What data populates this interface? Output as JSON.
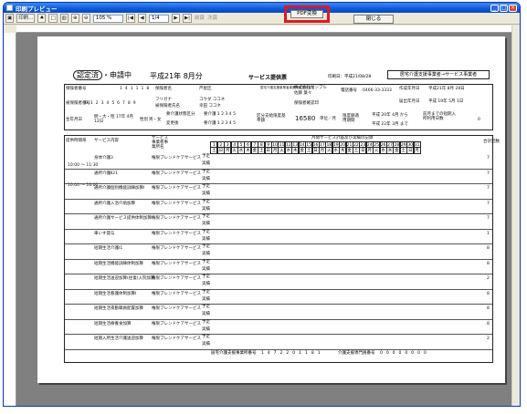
{
  "window": {
    "title": "印刷プレビュー",
    "min": "_",
    "max": "□",
    "close": "×"
  },
  "toolbar": {
    "print_label": "印刷...",
    "zoom": "105 %",
    "page": "1/4",
    "prev_label": "前頁",
    "next_label": "次頁",
    "pdf_label": "PDF変換",
    "close_label": "閉じる"
  },
  "doc": {
    "stamp_done": "認定済",
    "stamp_sep": "・",
    "stamp_applying": "申請中",
    "year_month": "平成21年 8月分",
    "title": "サービス提供票",
    "created": "印刷日：平成21/08/28",
    "provider_header": "居宅介護支援事業者→サービス事業者",
    "insured_no_label": "保険者番号",
    "insured_no": "141118",
    "insurer_name_label": "保険者名",
    "insurer_name": "芦屋区",
    "care_center_label": "居宅介護支援事業者事業所名担当者名",
    "care_center": "株式会社サンプル",
    "staff_label": "担当者",
    "staff": "佐藤 葉々",
    "phone_label": "電話番号",
    "phone": "0466-33-3333",
    "created_label": "作成年月日",
    "created_date": "平成21年 8月 28日",
    "person_no_label": "被保険者番号",
    "person_no": "0123456789",
    "furigana_label": "フリガナ",
    "furigana": "コウダ ココネ",
    "person_name_label": "被保険者氏名",
    "person_name": "幸田 ココネ",
    "insurer_confirm_label": "保険者確認印",
    "notify_label": "届出年月日",
    "notify_date": "平成 19年 5月 1日",
    "birth_label": "生年月日",
    "birth": "明・大・昭 17年 4月 12日",
    "sex_label": "性別",
    "sex": "男・女",
    "care_level_label": "要介護状態区分",
    "care_level": "要介護 1 2 3 4 5",
    "changed_label": "変更後",
    "changed_level": "要介護 1 2 3 4 5",
    "limit_label": "区分支給限度基準額",
    "limit": "16580",
    "limit_unit": "単位／月",
    "limit_period_label": "限度額適用期間",
    "period_from": "平成 20年 4月 から",
    "period_to": "平成 22年 3月 まで",
    "prev_month_label": "前月までの短期入所利用日数",
    "prev_month": "0",
    "col_time": "提供時間帯",
    "col_service": "サービス内容",
    "col_provider": "サービス事業者事業所名",
    "col_plan_actual": "予定/実績",
    "col_days_title": "月間サービス計画及び実績の記録",
    "col_total": "合計回数",
    "days": [
      "1",
      "2",
      "3",
      "4",
      "5",
      "6",
      "7",
      "8",
      "9",
      "10",
      "11",
      "12",
      "13",
      "14",
      "15",
      "16",
      "17",
      "18",
      "19",
      "20",
      "21",
      "22",
      "23",
      "24",
      "25",
      "26",
      "27",
      "28",
      "29",
      "30",
      "31"
    ],
    "weekdays": [
      "土",
      "日",
      "月",
      "火",
      "水",
      "木",
      "金",
      "土",
      "日",
      "月",
      "火",
      "水",
      "木",
      "金",
      "土",
      "日",
      "月",
      "火",
      "水",
      "木",
      "金",
      "土",
      "日",
      "月",
      "火",
      "水",
      "木",
      "金",
      "土",
      "日",
      "月"
    ],
    "plan": "予定",
    "actual": "実績",
    "times": [
      "10:00 ～ 11:30",
      "10:00 ～ 16:00"
    ],
    "rows": [
      {
        "service": "身体介護3",
        "provider": "権限ブレンドケアサービス",
        "total": "7"
      },
      {
        "service": "通所介護Ⅱ21",
        "provider": "権限ブレンドケアサービス",
        "total": "7"
      },
      {
        "service": "通所介護個別機能訓練加算Ⅰ",
        "provider": "権限ブレンドケアサービス",
        "total": "7"
      },
      {
        "service": "通所介護入浴介助加算",
        "provider": "権限ブレンドケアサービス",
        "total": "7"
      },
      {
        "service": "通所介護サービス提供体制加算Ⅰ",
        "provider": "権限ブレンドケアサービス",
        "total": "7"
      },
      {
        "service": "車いす貸与",
        "provider": "権限ブレンドケアサービス",
        "total": "1"
      },
      {
        "service": "短期生活介護Ⅰ1",
        "provider": "権限ブレンドケアサービス",
        "total": "8"
      },
      {
        "service": "短期生活機能訓練体制加算",
        "provider": "権限ブレンドケアサービス",
        "total": "8"
      },
      {
        "service": "短期生活送迎加算(往復)入院加算",
        "provider": "権限ブレンドケアサービス",
        "total": "2"
      },
      {
        "service": "短期生活看護体制加算Ⅰ",
        "provider": "権限ブレンドケアサービス",
        "total": "8"
      },
      {
        "service": "短期生活夜勤職員配置加算",
        "provider": "権限ブレンドケアサービス",
        "total": "8"
      },
      {
        "service": "短期生活療養食加算",
        "provider": "権限ブレンドケアサービス",
        "total": "8"
      },
      {
        "service": "短期入所生活介護送迎加算",
        "provider": "権限ブレンドケアサービス",
        "total": "2"
      }
    ],
    "footer_care_label": "居宅介護支援事業所番号",
    "footer_care_no": "1472201181",
    "footer_manager_label": "介護支援専門員番号",
    "footer_manager_no": "00000000"
  }
}
